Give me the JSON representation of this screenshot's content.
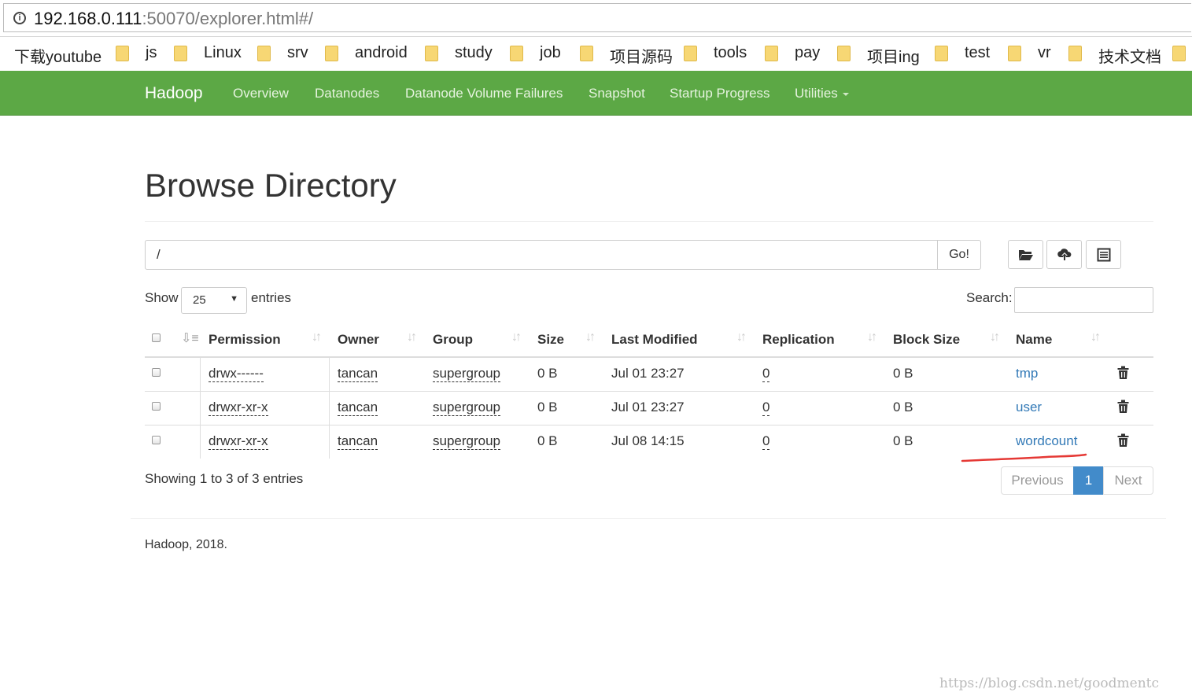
{
  "browser": {
    "url_host": "192.168.0.111",
    "url_rest": ":50070/explorer.html#/",
    "bookmarks": [
      "下载youtube",
      "js",
      "Linux",
      "srv",
      "android",
      "study",
      "job",
      "项目源码",
      "tools",
      "pay",
      "项目ing",
      "test",
      "vr",
      "技术文档"
    ]
  },
  "navbar": {
    "brand": "Hadoop",
    "items": [
      "Overview",
      "Datanodes",
      "Datanode Volume Failures",
      "Snapshot",
      "Startup Progress",
      "Utilities"
    ]
  },
  "page": {
    "title": "Browse Directory",
    "path_value": "/",
    "go_label": "Go!",
    "tool_icons": [
      "folder-open-icon",
      "cloud-upload-icon",
      "list-alt-icon"
    ],
    "show_label": "Show",
    "page_length": "25",
    "entries_label": "entries",
    "search_label": "Search:",
    "search_value": ""
  },
  "table": {
    "headers": [
      "Permission",
      "Owner",
      "Group",
      "Size",
      "Last Modified",
      "Replication",
      "Block Size",
      "Name"
    ],
    "rows": [
      {
        "permission": "drwx------",
        "owner": "tancan",
        "group": "supergroup",
        "size": "0 B",
        "modified": "Jul 01 23:27",
        "replication": "0",
        "block_size": "0 B",
        "name": "tmp"
      },
      {
        "permission": "drwxr-xr-x",
        "owner": "tancan",
        "group": "supergroup",
        "size": "0 B",
        "modified": "Jul 01 23:27",
        "replication": "0",
        "block_size": "0 B",
        "name": "user"
      },
      {
        "permission": "drwxr-xr-x",
        "owner": "tancan",
        "group": "supergroup",
        "size": "0 B",
        "modified": "Jul 08 14:15",
        "replication": "0",
        "block_size": "0 B",
        "name": "wordcount"
      }
    ]
  },
  "pagination": {
    "info": "Showing 1 to 3 of 3 entries",
    "previous": "Previous",
    "current": "1",
    "next": "Next"
  },
  "footer": {
    "text": "Hadoop, 2018."
  },
  "watermark": "https://blog.csdn.net/goodmentc",
  "colors": {
    "navbar": "#5ca845",
    "link": "#337ab7",
    "active_page": "#428bca",
    "annotation": "#e53935"
  }
}
